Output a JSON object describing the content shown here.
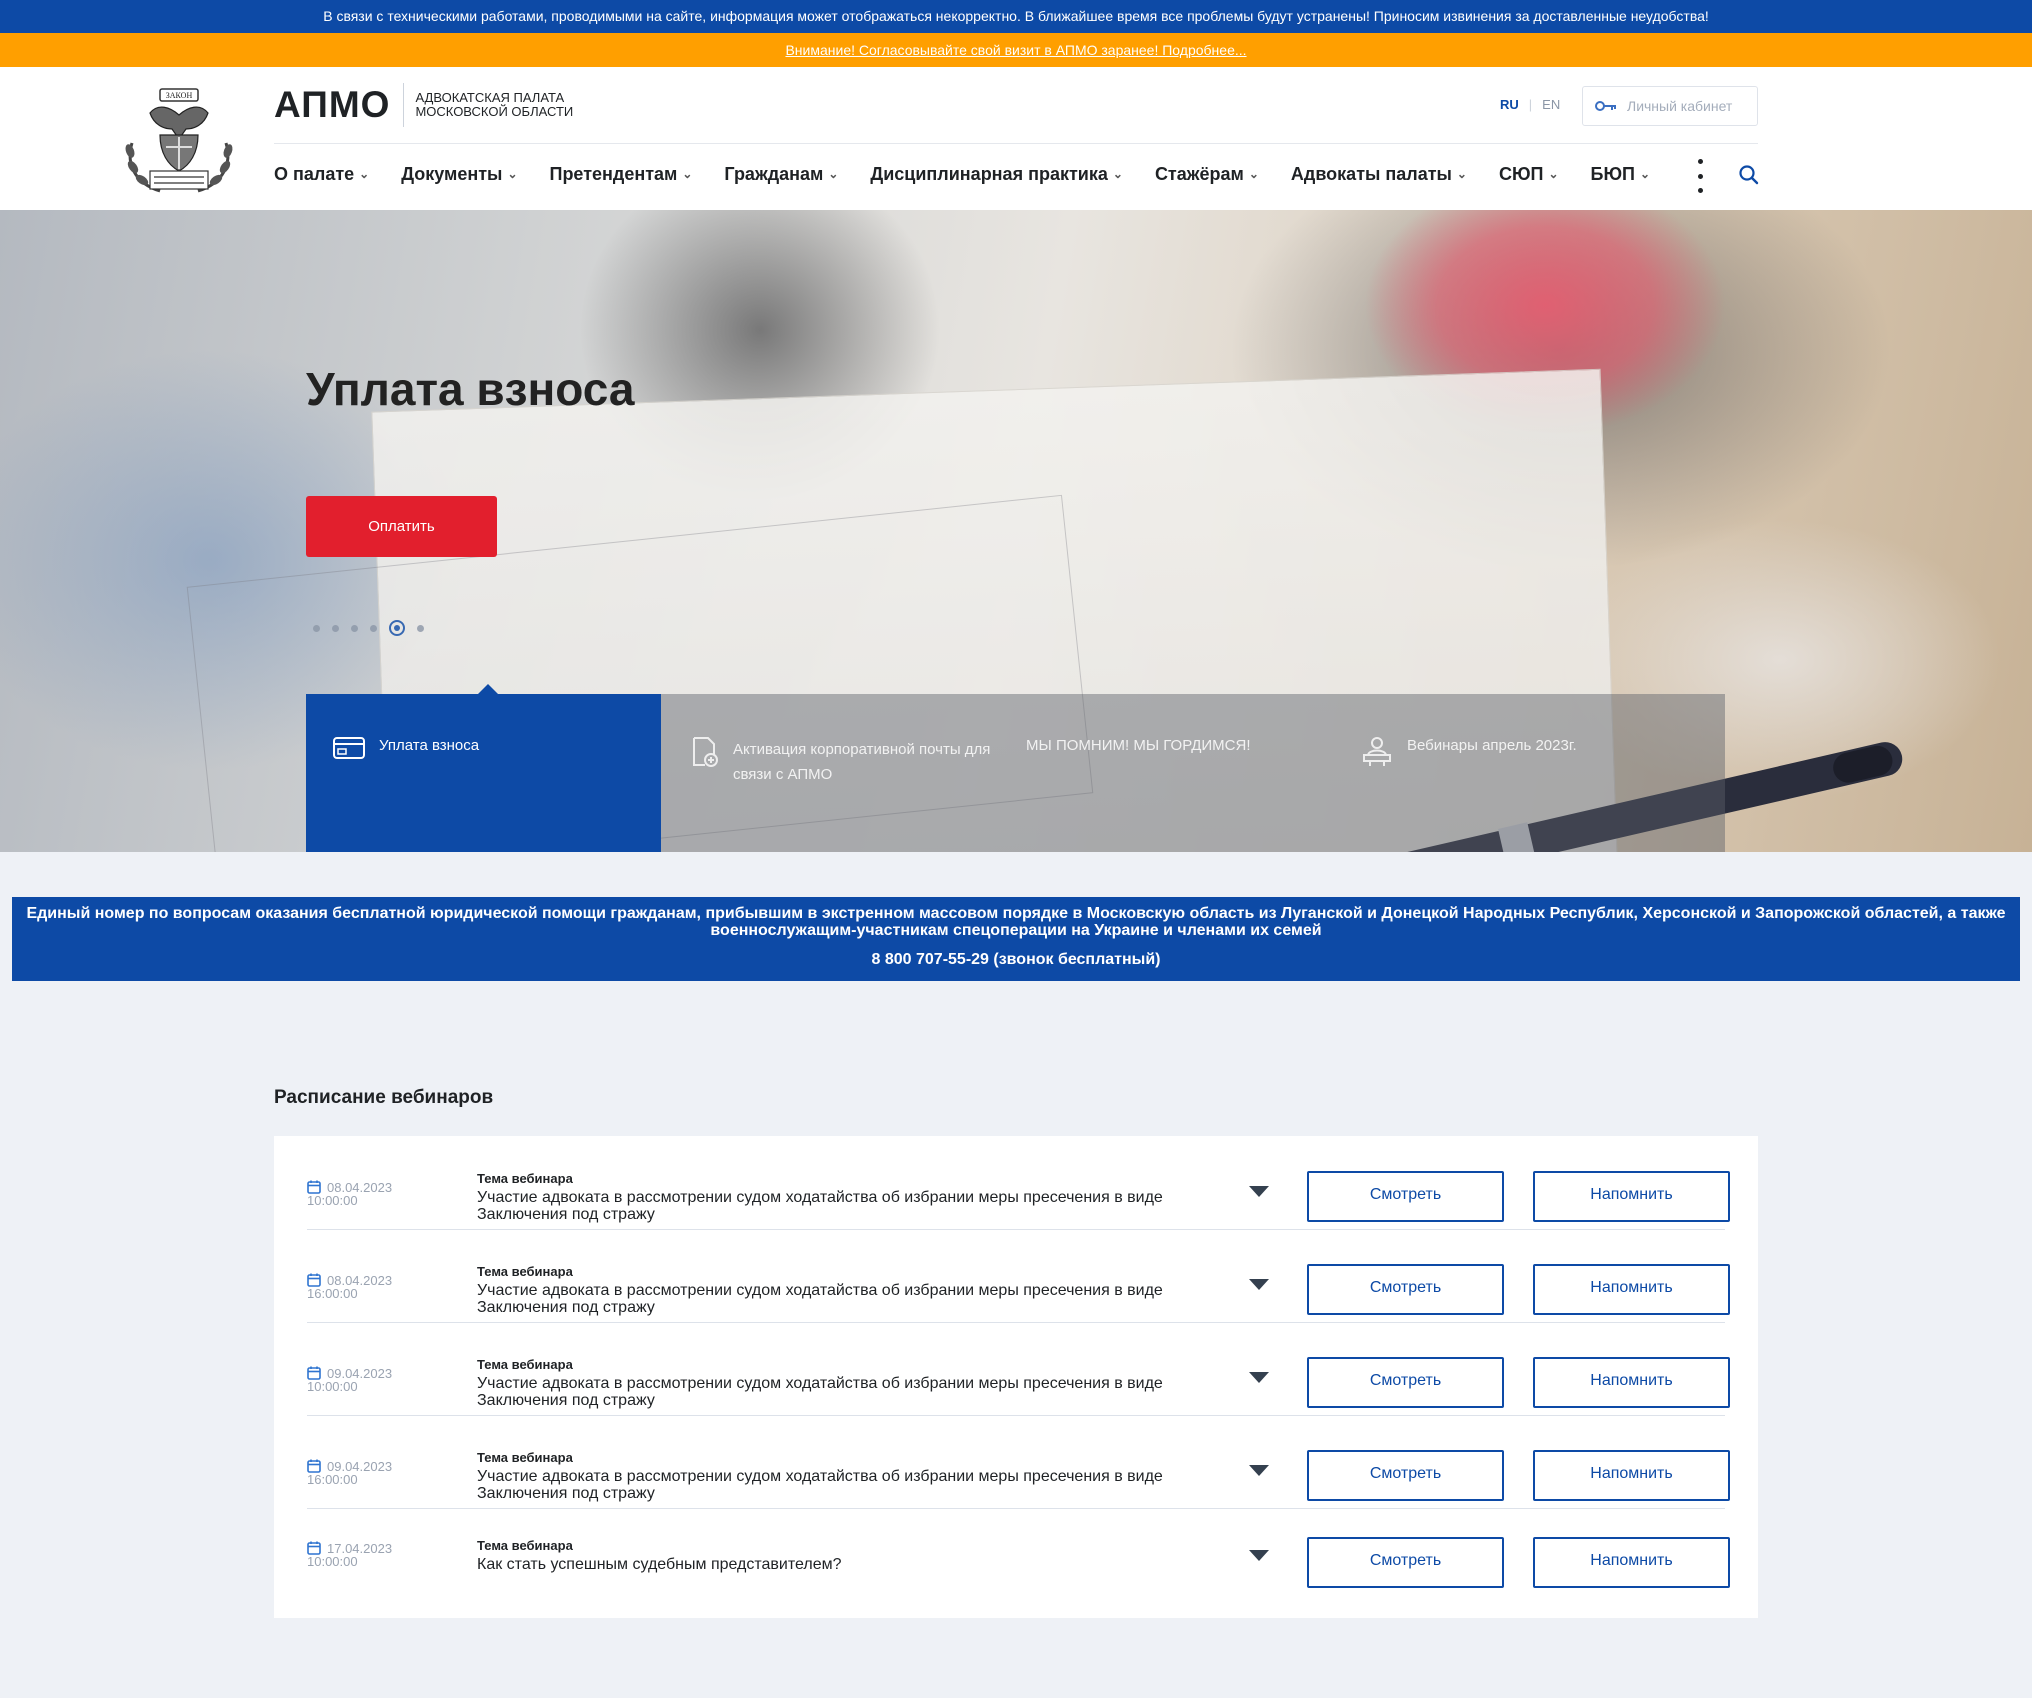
{
  "notices": {
    "tech": "В связи с техническими работами, проводимыми на сайте, информация может отображаться некорректно. В ближайшее время все проблемы будут устранены! Приносим извинения за доставленные неудобства!",
    "visit": "Внимание! Согласовывайте свой визит в АПМО заранее! Подробнее..."
  },
  "header": {
    "brand": "АПМО",
    "brand_sub": "Адвокатская палата Московской области",
    "logo_text_top": "ЗАКОН",
    "logo_text_bottom": "АДВОКАТСКАЯ ПАЛАТА МОСКОВСКОЙ ОБЛАСТИ",
    "lang": {
      "ru": "RU",
      "en": "EN"
    },
    "cabinet": "Личный кабинет"
  },
  "nav": {
    "items": [
      {
        "label": "О палате"
      },
      {
        "label": "Документы"
      },
      {
        "label": "Претендентам"
      },
      {
        "label": "Гражданам"
      },
      {
        "label": "Дисциплинарная практика"
      },
      {
        "label": "Стажёрам"
      },
      {
        "label": "Адвокаты палаты"
      },
      {
        "label": "СЮП"
      },
      {
        "label": "БЮП"
      }
    ]
  },
  "hero": {
    "title": "Уплата взноса",
    "button": "Оплатить",
    "slides_total": 6,
    "active_slide": 5
  },
  "tabs": [
    {
      "label": "Уплата взноса",
      "icon": "card-icon"
    },
    {
      "label": "Активация корпоративной почты для связи с АПМО",
      "icon": "document-icon"
    },
    {
      "label": "МЫ ПОМНИМ! МЫ ГОРДИМСЯ!",
      "icon": ""
    },
    {
      "label": "Вебинары апрель 2023г.",
      "icon": "webinar-icon"
    }
  ],
  "info": {
    "text": "Единый номер по вопросам оказания бесплатной юридической помощи гражданам, прибывшим в экстренном массовом порядке в Московскую область из Луганской и Донецкой Народных Республик, Херсонской и Запорожской областей, а также военнослужащим-участникам спецоперации на Украине и членами их семей",
    "phone": "8 800 707-55-29 (звонок бесплатный)"
  },
  "webinars": {
    "title": "Расписание вебинаров",
    "topic_label": "Тема вебинара",
    "watch_label": "Смотреть",
    "remind_label": "Напомнить",
    "rows": [
      {
        "date": "08.04.2023",
        "time": "10:00:00",
        "topic": "Участие адвоката в рассмотрении судом ходатайства об избрании меры пресечения в виде Заключения под стражу"
      },
      {
        "date": "08.04.2023",
        "time": "16:00:00",
        "topic": "Участие адвоката в рассмотрении судом ходатайства об избрании меры пресечения в виде Заключения под стражу"
      },
      {
        "date": "09.04.2023",
        "time": "10:00:00",
        "topic": "Участие адвоката в рассмотрении судом ходатайства об избрании меры пресечения в виде Заключения под стражу"
      },
      {
        "date": "09.04.2023",
        "time": "16:00:00",
        "topic": "Участие адвоката в рассмотрении судом ходатайства об избрании меры пресечения в виде Заключения под стражу"
      },
      {
        "date": "17.04.2023",
        "time": "10:00:00",
        "topic": "Как стать успешным судебным представителем?"
      }
    ]
  },
  "colors": {
    "primary_blue": "#0d4aa6",
    "warning_orange": "#ff9f00",
    "pay_red": "#e21f2d"
  }
}
